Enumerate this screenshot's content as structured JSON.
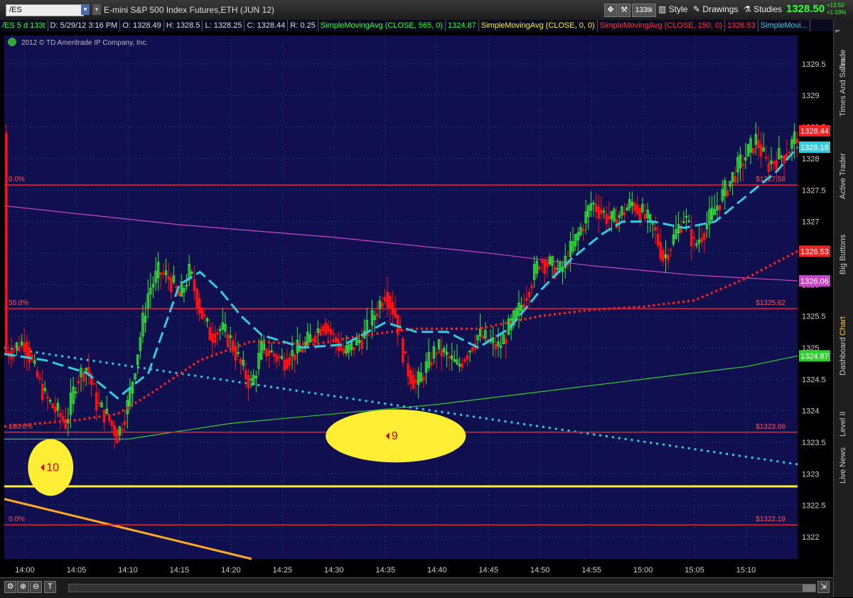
{
  "toolbar": {
    "symbol": "/ES",
    "description": "E-mini S&P 500 Index Futures,ETH (JUN 12)",
    "tick_label": "133tk",
    "style_label": "Style",
    "drawings_label": "Drawings",
    "studies_label": "Studies",
    "last_price": "1328.50",
    "change_abs": "+13.50",
    "change_pct": "+1.03%"
  },
  "infobar": {
    "range": "/ES 5 d 133t",
    "datetime": "D: 5/29/12 3:16 PM",
    "open": "O: 1328.49",
    "high": "H: 1328.5",
    "low": "L: 1328.25",
    "close": "C: 1328.44",
    "r": "R: 0.25",
    "sma1_label": "SimpleMovingAvg (CLOSE, 565, 0)",
    "sma1_value": "1324.87",
    "sma2_label": "SimpleMovingAvg (CLOSE, 0, 0)",
    "sma3_label": "SimpleMovingAvg (CLOSE, 150, 0)",
    "sma3_value": "1326.53",
    "sma4_label": "SimpleMovi..."
  },
  "copyright": "2012 © TD Ameritrade IP Company, Inc.",
  "side_tabs": [
    "Trade",
    "Times And Sales",
    "Active Trader",
    "Big Buttons",
    "Chart",
    "Dashboard",
    "Level II",
    "Live News"
  ],
  "colors": {
    "background": "#10104e",
    "grid": "#262b74",
    "up": "#33ee33",
    "down": "#ff1111",
    "cyan": "#33ccdd",
    "red_ma": "#ee2222",
    "magenta": "#cc44cc",
    "green_ma": "#33cc33",
    "fib": "#ee2222",
    "fib_label": "#ff5555",
    "yellow": "#ffee33",
    "orange": "#ffaa22"
  },
  "chart_data": {
    "type": "candlestick",
    "x_ticks": [
      "14:00",
      "14:05",
      "14:10",
      "14:15",
      "14:20",
      "14:25",
      "14:30",
      "14:35",
      "14:40",
      "14:45",
      "14:50",
      "14:55",
      "15:00",
      "15:05",
      "15:10"
    ],
    "x_tick_minutes": [
      0,
      5,
      10,
      15,
      20,
      25,
      30,
      35,
      40,
      45,
      50,
      55,
      60,
      65,
      70
    ],
    "x_range_minutes": [
      -2,
      75
    ],
    "y_ticks": [
      "1322",
      "1322.5",
      "1323",
      "1323.5",
      "1324",
      "1324.5",
      "1325",
      "1325.5",
      "1326",
      "1326.5",
      "1327",
      "1327.5",
      "1328",
      "1328.5",
      "1329",
      "1329.5"
    ],
    "ylim": [
      1321.65,
      1329.95
    ],
    "price_labels": [
      {
        "value": 1328.44,
        "text": "1328.44",
        "color": "#ee2222"
      },
      {
        "value": 1328.18,
        "text": "1328.18",
        "color": "#33ccdd"
      },
      {
        "value": 1326.53,
        "text": "1326.53",
        "color": "#ee2222"
      },
      {
        "value": 1326.06,
        "text": "1326.06",
        "color": "#cc44cc"
      },
      {
        "value": 1324.87,
        "text": "1324.87",
        "color": "#33cc33"
      }
    ],
    "fib_levels": [
      {
        "value": 1327.58,
        "left": "0.0%",
        "right": "$1327.58"
      },
      {
        "value": 1325.62,
        "left": "50.0%",
        "right": "$1325.62"
      },
      {
        "value": 1323.66,
        "left": "100.0%",
        "right": "$1323.66"
      },
      {
        "value": 1322.19,
        "left": "0.0%",
        "right": "$1322.19"
      }
    ],
    "horizontal_line_yellow": 1322.8,
    "orange_trend": [
      [
        -2,
        1322.6
      ],
      [
        22,
        1321.65
      ]
    ],
    "cyan_dotted_trend": [
      [
        -2,
        1325.0
      ],
      [
        75,
        1323.15
      ]
    ],
    "magenta_ma": [
      [
        -2,
        1327.25
      ],
      [
        15,
        1326.95
      ],
      [
        30,
        1326.75
      ],
      [
        45,
        1326.5
      ],
      [
        55,
        1326.3
      ],
      [
        65,
        1326.15
      ],
      [
        75,
        1326.06
      ]
    ],
    "green_ma": [
      [
        -2,
        1323.55
      ],
      [
        10,
        1323.55
      ],
      [
        20,
        1323.8
      ],
      [
        30,
        1323.95
      ],
      [
        40,
        1324.1
      ],
      [
        50,
        1324.3
      ],
      [
        60,
        1324.5
      ],
      [
        70,
        1324.7
      ],
      [
        75,
        1324.87
      ]
    ],
    "red_ma": [
      [
        -2,
        1323.75
      ],
      [
        5,
        1323.85
      ],
      [
        9,
        1323.95
      ],
      [
        12,
        1324.25
      ],
      [
        17,
        1324.8
      ],
      [
        22,
        1325.1
      ],
      [
        28,
        1325.05
      ],
      [
        33,
        1325.2
      ],
      [
        38,
        1325.3
      ],
      [
        44,
        1325.3
      ],
      [
        50,
        1325.5
      ],
      [
        55,
        1325.6
      ],
      [
        60,
        1325.65
      ],
      [
        65,
        1325.75
      ],
      [
        70,
        1326.1
      ],
      [
        75,
        1326.53
      ]
    ],
    "cyan_ma": [
      [
        -2,
        1324.9
      ],
      [
        2,
        1324.8
      ],
      [
        6,
        1324.6
      ],
      [
        9,
        1324.2
      ],
      [
        12,
        1324.6
      ],
      [
        15,
        1326.0
      ],
      [
        17,
        1326.2
      ],
      [
        19,
        1325.9
      ],
      [
        21,
        1325.5
      ],
      [
        23,
        1325.2
      ],
      [
        27,
        1325.0
      ],
      [
        31,
        1325.05
      ],
      [
        35,
        1325.4
      ],
      [
        38,
        1325.25
      ],
      [
        41,
        1325.25
      ],
      [
        44,
        1325.0
      ],
      [
        47,
        1325.3
      ],
      [
        50,
        1325.9
      ],
      [
        53,
        1326.4
      ],
      [
        56,
        1326.8
      ],
      [
        58,
        1327.0
      ],
      [
        61,
        1327.0
      ],
      [
        64,
        1326.9
      ],
      [
        67,
        1327.0
      ],
      [
        70,
        1327.4
      ],
      [
        73,
        1327.8
      ],
      [
        75,
        1328.18
      ]
    ],
    "price_path": [
      [
        -2,
        1324.9
      ],
      [
        0,
        1325.1
      ],
      [
        1,
        1324.6
      ],
      [
        2,
        1324.2
      ],
      [
        3,
        1324.0
      ],
      [
        4,
        1323.8
      ],
      [
        5,
        1324.5
      ],
      [
        6,
        1324.7
      ],
      [
        7,
        1324.1
      ],
      [
        8,
        1323.9
      ],
      [
        9,
        1323.6
      ],
      [
        10,
        1324.1
      ],
      [
        11,
        1325.0
      ],
      [
        12,
        1325.9
      ],
      [
        13,
        1326.2
      ],
      [
        14,
        1326.1
      ],
      [
        15,
        1325.8
      ],
      [
        16,
        1326.2
      ],
      [
        17,
        1325.6
      ],
      [
        18,
        1325.2
      ],
      [
        19,
        1325.3
      ],
      [
        20,
        1325.1
      ],
      [
        21,
        1324.7
      ],
      [
        22,
        1324.4
      ],
      [
        23,
        1325.0
      ],
      [
        25,
        1324.8
      ],
      [
        27,
        1325.0
      ],
      [
        29,
        1325.4
      ],
      [
        31,
        1324.9
      ],
      [
        33,
        1325.2
      ],
      [
        35,
        1325.9
      ],
      [
        36,
        1325.5
      ],
      [
        37,
        1324.7
      ],
      [
        38,
        1324.4
      ],
      [
        40,
        1325.0
      ],
      [
        42,
        1324.7
      ],
      [
        44,
        1325.2
      ],
      [
        46,
        1325.0
      ],
      [
        48,
        1325.6
      ],
      [
        50,
        1326.4
      ],
      [
        52,
        1326.2
      ],
      [
        54,
        1326.9
      ],
      [
        55,
        1327.3
      ],
      [
        57,
        1327.0
      ],
      [
        59,
        1327.3
      ],
      [
        61,
        1326.9
      ],
      [
        62,
        1326.4
      ],
      [
        64,
        1327.1
      ],
      [
        65,
        1326.6
      ],
      [
        67,
        1327.2
      ],
      [
        69,
        1327.8
      ],
      [
        71,
        1328.3
      ],
      [
        72,
        1327.9
      ],
      [
        74,
        1328.1
      ],
      [
        75,
        1328.4
      ]
    ],
    "annotations": [
      {
        "text": "10",
        "x": 2.5,
        "y": 1323.1,
        "ellipse_rx_min": 2.2,
        "ellipse_ry": 0.45
      },
      {
        "text": "9",
        "x": 36,
        "y": 1323.6,
        "ellipse_rx_min": 6.8,
        "ellipse_ry": 0.42
      }
    ],
    "grid": true
  }
}
